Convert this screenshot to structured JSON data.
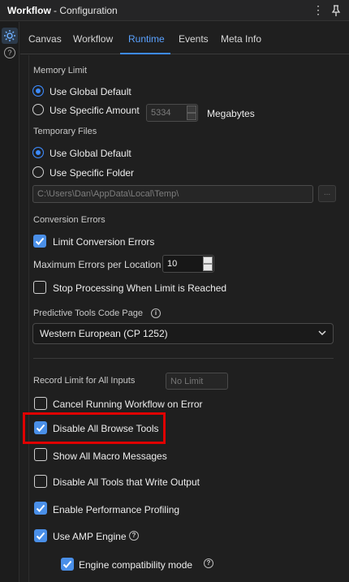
{
  "title": {
    "app": "Workflow",
    "sub": "- Configuration"
  },
  "toolbar": {
    "more_icon": "more-vertical-icon",
    "pin_icon": "pin-icon"
  },
  "sidebar": {
    "settings_icon": "gear-icon",
    "help_icon": "help-circle-icon",
    "help_glyph": "?"
  },
  "tabs": [
    {
      "label": "Canvas"
    },
    {
      "label": "Workflow"
    },
    {
      "label": "Runtime",
      "active": true
    },
    {
      "label": "Events"
    },
    {
      "label": "Meta Info"
    }
  ],
  "memory": {
    "section": "Memory Limit",
    "global": "Use Global Default",
    "specific": "Use Specific Amount",
    "amount": "5334",
    "unit": "Megabytes",
    "selected": "global"
  },
  "temp": {
    "section": "Temporary Files",
    "global": "Use Global Default",
    "specific": "Use Specific Folder",
    "path": "C:\\Users\\Dan\\AppData\\Local\\Temp\\",
    "browse": "...",
    "selected": "global"
  },
  "conversion": {
    "section": "Conversion Errors",
    "limit": {
      "label": "Limit Conversion Errors",
      "checked": true
    },
    "max_label": "Maximum Errors per Location",
    "max_value": "10",
    "stop": {
      "label": "Stop Processing When Limit is Reached",
      "checked": false
    }
  },
  "codepage": {
    "section": "Predictive Tools Code Page",
    "value": "Western European (CP 1252)",
    "info_glyph": "i"
  },
  "record_limit": {
    "label": "Record Limit for All Inputs",
    "placeholder": "No Limit"
  },
  "options": [
    {
      "label": "Cancel Running Workflow on Error",
      "checked": false
    },
    {
      "label": "Disable All Browse Tools",
      "checked": true,
      "highlighted": true
    },
    {
      "label": "Show All Macro Messages",
      "checked": false
    },
    {
      "label": "Disable All Tools that Write Output",
      "checked": false
    },
    {
      "label": "Enable Performance Profiling",
      "checked": true
    },
    {
      "label": "Use AMP Engine",
      "checked": true
    },
    {
      "label": "Engine compatibility mode",
      "checked": true
    }
  ],
  "colors": {
    "accent": "#3d8bfd",
    "highlight": "#e00000",
    "background": "#1f1f1f"
  }
}
